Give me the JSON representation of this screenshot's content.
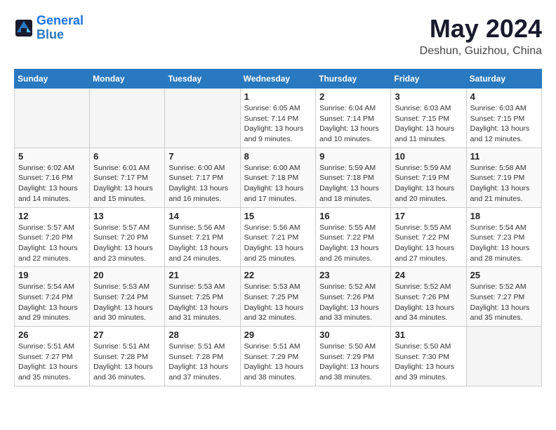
{
  "logo": {
    "line1": "General",
    "line2": "Blue"
  },
  "title": "May 2024",
  "subtitle": "Deshun, Guizhou, China",
  "weekdays": [
    "Sunday",
    "Monday",
    "Tuesday",
    "Wednesday",
    "Thursday",
    "Friday",
    "Saturday"
  ],
  "weeks": [
    [
      {
        "day": "",
        "info": ""
      },
      {
        "day": "",
        "info": ""
      },
      {
        "day": "",
        "info": ""
      },
      {
        "day": "1",
        "info": "Sunrise: 6:05 AM\nSunset: 7:14 PM\nDaylight: 13 hours\nand 9 minutes."
      },
      {
        "day": "2",
        "info": "Sunrise: 6:04 AM\nSunset: 7:14 PM\nDaylight: 13 hours\nand 10 minutes."
      },
      {
        "day": "3",
        "info": "Sunrise: 6:03 AM\nSunset: 7:15 PM\nDaylight: 13 hours\nand 11 minutes."
      },
      {
        "day": "4",
        "info": "Sunrise: 6:03 AM\nSunset: 7:15 PM\nDaylight: 13 hours\nand 12 minutes."
      }
    ],
    [
      {
        "day": "5",
        "info": "Sunrise: 6:02 AM\nSunset: 7:16 PM\nDaylight: 13 hours\nand 14 minutes."
      },
      {
        "day": "6",
        "info": "Sunrise: 6:01 AM\nSunset: 7:17 PM\nDaylight: 13 hours\nand 15 minutes."
      },
      {
        "day": "7",
        "info": "Sunrise: 6:00 AM\nSunset: 7:17 PM\nDaylight: 13 hours\nand 16 minutes."
      },
      {
        "day": "8",
        "info": "Sunrise: 6:00 AM\nSunset: 7:18 PM\nDaylight: 13 hours\nand 17 minutes."
      },
      {
        "day": "9",
        "info": "Sunrise: 5:59 AM\nSunset: 7:18 PM\nDaylight: 13 hours\nand 18 minutes."
      },
      {
        "day": "10",
        "info": "Sunrise: 5:59 AM\nSunset: 7:19 PM\nDaylight: 13 hours\nand 20 minutes."
      },
      {
        "day": "11",
        "info": "Sunrise: 5:58 AM\nSunset: 7:19 PM\nDaylight: 13 hours\nand 21 minutes."
      }
    ],
    [
      {
        "day": "12",
        "info": "Sunrise: 5:57 AM\nSunset: 7:20 PM\nDaylight: 13 hours\nand 22 minutes."
      },
      {
        "day": "13",
        "info": "Sunrise: 5:57 AM\nSunset: 7:20 PM\nDaylight: 13 hours\nand 23 minutes."
      },
      {
        "day": "14",
        "info": "Sunrise: 5:56 AM\nSunset: 7:21 PM\nDaylight: 13 hours\nand 24 minutes."
      },
      {
        "day": "15",
        "info": "Sunrise: 5:56 AM\nSunset: 7:21 PM\nDaylight: 13 hours\nand 25 minutes."
      },
      {
        "day": "16",
        "info": "Sunrise: 5:55 AM\nSunset: 7:22 PM\nDaylight: 13 hours\nand 26 minutes."
      },
      {
        "day": "17",
        "info": "Sunrise: 5:55 AM\nSunset: 7:22 PM\nDaylight: 13 hours\nand 27 minutes."
      },
      {
        "day": "18",
        "info": "Sunrise: 5:54 AM\nSunset: 7:23 PM\nDaylight: 13 hours\nand 28 minutes."
      }
    ],
    [
      {
        "day": "19",
        "info": "Sunrise: 5:54 AM\nSunset: 7:24 PM\nDaylight: 13 hours\nand 29 minutes."
      },
      {
        "day": "20",
        "info": "Sunrise: 5:53 AM\nSunset: 7:24 PM\nDaylight: 13 hours\nand 30 minutes."
      },
      {
        "day": "21",
        "info": "Sunrise: 5:53 AM\nSunset: 7:25 PM\nDaylight: 13 hours\nand 31 minutes."
      },
      {
        "day": "22",
        "info": "Sunrise: 5:53 AM\nSunset: 7:25 PM\nDaylight: 13 hours\nand 32 minutes."
      },
      {
        "day": "23",
        "info": "Sunrise: 5:52 AM\nSunset: 7:26 PM\nDaylight: 13 hours\nand 33 minutes."
      },
      {
        "day": "24",
        "info": "Sunrise: 5:52 AM\nSunset: 7:26 PM\nDaylight: 13 hours\nand 34 minutes."
      },
      {
        "day": "25",
        "info": "Sunrise: 5:52 AM\nSunset: 7:27 PM\nDaylight: 13 hours\nand 35 minutes."
      }
    ],
    [
      {
        "day": "26",
        "info": "Sunrise: 5:51 AM\nSunset: 7:27 PM\nDaylight: 13 hours\nand 35 minutes."
      },
      {
        "day": "27",
        "info": "Sunrise: 5:51 AM\nSunset: 7:28 PM\nDaylight: 13 hours\nand 36 minutes."
      },
      {
        "day": "28",
        "info": "Sunrise: 5:51 AM\nSunset: 7:28 PM\nDaylight: 13 hours\nand 37 minutes."
      },
      {
        "day": "29",
        "info": "Sunrise: 5:51 AM\nSunset: 7:29 PM\nDaylight: 13 hours\nand 38 minutes."
      },
      {
        "day": "30",
        "info": "Sunrise: 5:50 AM\nSunset: 7:29 PM\nDaylight: 13 hours\nand 38 minutes."
      },
      {
        "day": "31",
        "info": "Sunrise: 5:50 AM\nSunset: 7:30 PM\nDaylight: 13 hours\nand 39 minutes."
      },
      {
        "day": "",
        "info": ""
      }
    ]
  ]
}
